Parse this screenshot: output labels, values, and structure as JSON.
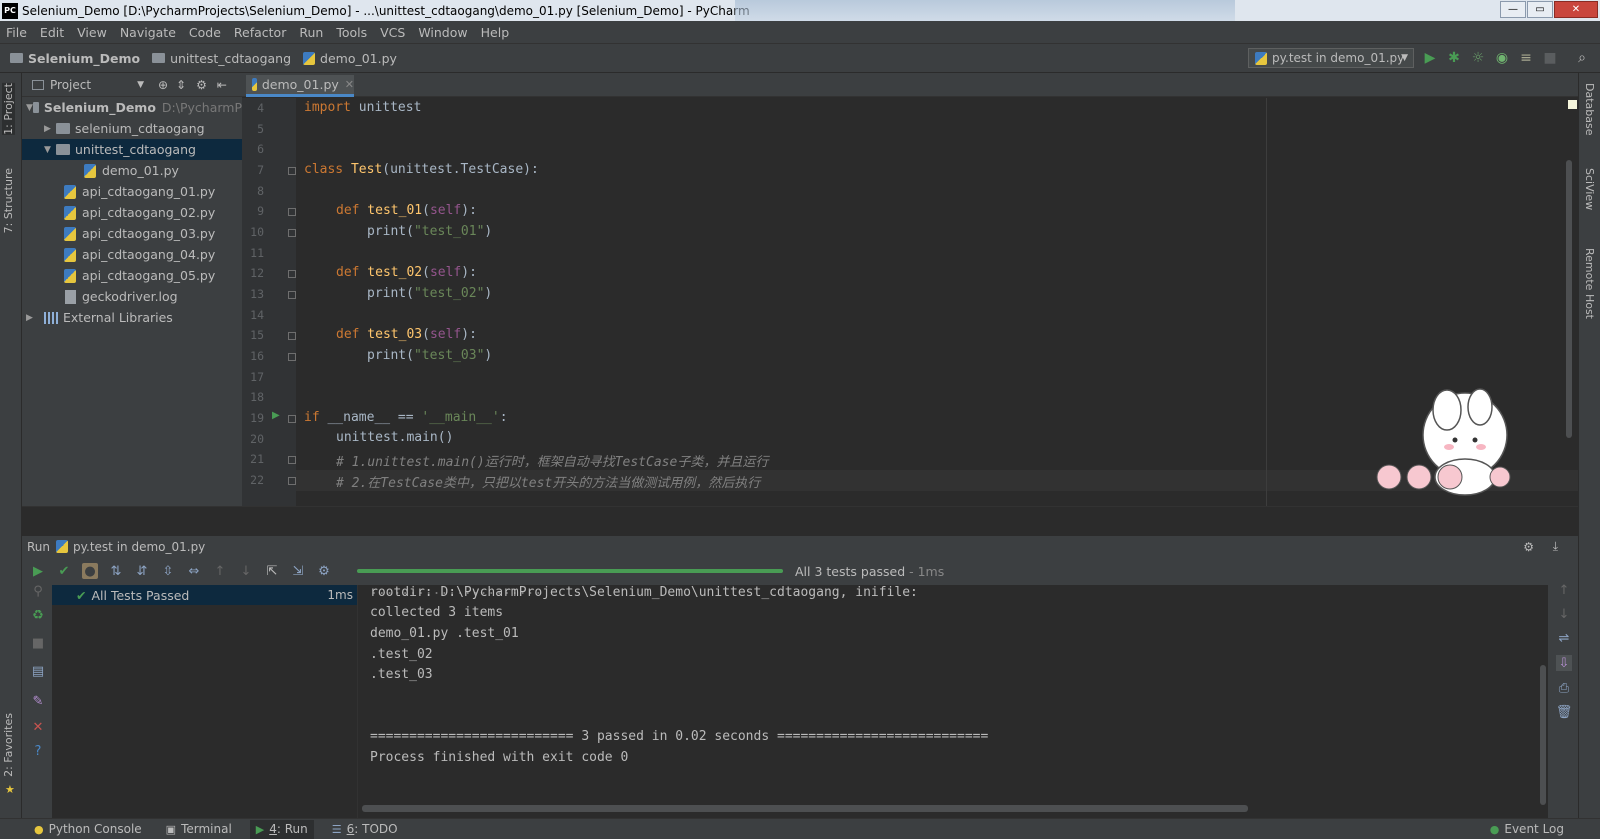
{
  "window": {
    "title": "Selenium_Demo [D:\\PycharmProjects\\Selenium_Demo] - ...\\unittest_cdtaogang\\demo_01.py [Selenium_Demo] - PyCharm",
    "logo": "PC",
    "minimize": "—",
    "maximize": "▭",
    "close": "✕"
  },
  "menu": [
    "File",
    "Edit",
    "View",
    "Navigate",
    "Code",
    "Refactor",
    "Run",
    "Tools",
    "VCS",
    "Window",
    "Help"
  ],
  "breadcrumb": {
    "project": "Selenium_Demo",
    "folder": "unittest_cdtaogang",
    "file": "demo_01.py"
  },
  "run_config": {
    "label": "py.test in demo_01.py"
  },
  "left_tabs": {
    "project": "1: Project",
    "structure": "7: Structure",
    "favorites": "2: Favorites"
  },
  "right_tabs": {
    "database": "Database",
    "sciview": "SciView",
    "remote": "Remote Host"
  },
  "project_panel": {
    "header": "Project",
    "tree": [
      {
        "label": "Selenium_Demo",
        "extra": "D:\\PycharmP",
        "type": "project"
      },
      {
        "label": "selenium_cdtaogang",
        "type": "folder"
      },
      {
        "label": "unittest_cdtaogang",
        "type": "folder-open"
      },
      {
        "label": "demo_01.py",
        "type": "py"
      },
      {
        "label": "api_cdtaogang_01.py",
        "type": "py"
      },
      {
        "label": "api_cdtaogang_02.py",
        "type": "py"
      },
      {
        "label": "api_cdtaogang_03.py",
        "type": "py"
      },
      {
        "label": "api_cdtaogang_04.py",
        "type": "py"
      },
      {
        "label": "api_cdtaogang_05.py",
        "type": "py"
      },
      {
        "label": "geckodriver.log",
        "type": "log"
      },
      {
        "label": "External Libraries",
        "type": "libs"
      }
    ]
  },
  "editor": {
    "tab": "demo_01.py",
    "line_numbers": [
      "4",
      "5",
      "6",
      "7",
      "8",
      "9",
      "10",
      "11",
      "12",
      "13",
      "14",
      "15",
      "16",
      "17",
      "18",
      "19",
      "20",
      "21",
      "22"
    ],
    "code": {
      "l4_kw": "import",
      "l4_rest": " unittest",
      "l7_kw": "class",
      "l7_name": " Test",
      "l7_rest": "(unittest.TestCase):",
      "l9_kw": "def",
      "l9_fn": " test_01",
      "l9_open": "(",
      "l9_self": "self",
      "l9_close": "):",
      "l10_fn": "print",
      "l10_open": "(",
      "l10_str": "\"test_01\"",
      "l10_close": ")",
      "l12_kw": "def",
      "l12_fn": " test_02",
      "l12_open": "(",
      "l12_self": "self",
      "l12_close": "):",
      "l13_fn": "print",
      "l13_open": "(",
      "l13_str": "\"test_02\"",
      "l13_close": ")",
      "l15_kw": "def",
      "l15_fn": " test_03",
      "l15_open": "(",
      "l15_self": "self",
      "l15_close": "):",
      "l16_fn": "print",
      "l16_open": "(",
      "l16_str": "\"test_03\"",
      "l16_close": ")",
      "l19_kw": "if",
      "l19_mid": " __name__ == ",
      "l19_str": "'__main__'",
      "l19_rest": ":",
      "l20": "unittest.main()",
      "l21": "# 1.unittest.main()运行时，框架自动寻找TestCase子类，并且运行",
      "l22": "# 2.在TestCase类中，只把以test开头的方法当做测试用例，然后执行"
    }
  },
  "run_panel": {
    "header_label": "Run",
    "header_config": "py.test in demo_01.py",
    "status": "All 3 tests passed",
    "status_time": " - 1ms",
    "progress": 1.0,
    "test_tree": {
      "label": "All Tests Passed",
      "time": "1ms"
    },
    "console": [
      "rootdir: D:\\PycharmProjects\\Selenium_Demo\\unittest_cdtaogang, inifile:",
      "collected 3 items",
      "demo_01.py .test_01",
      ".test_02",
      ".test_03",
      "",
      "",
      "========================== 3 passed in 0.02 seconds ===========================",
      "Process finished with exit code 0"
    ]
  },
  "statusbar": {
    "python_console": "Python Console",
    "terminal": "Terminal",
    "run_num": "4",
    "run": ": Run",
    "todo_num": "6",
    "todo": ": TODO",
    "event_log": "Event Log"
  },
  "colors": {
    "keyword": "#cc7832",
    "function": "#ffc66d",
    "string": "#6a8759",
    "comment": "#808080",
    "success": "#499c54",
    "selection": "#0d293e"
  }
}
